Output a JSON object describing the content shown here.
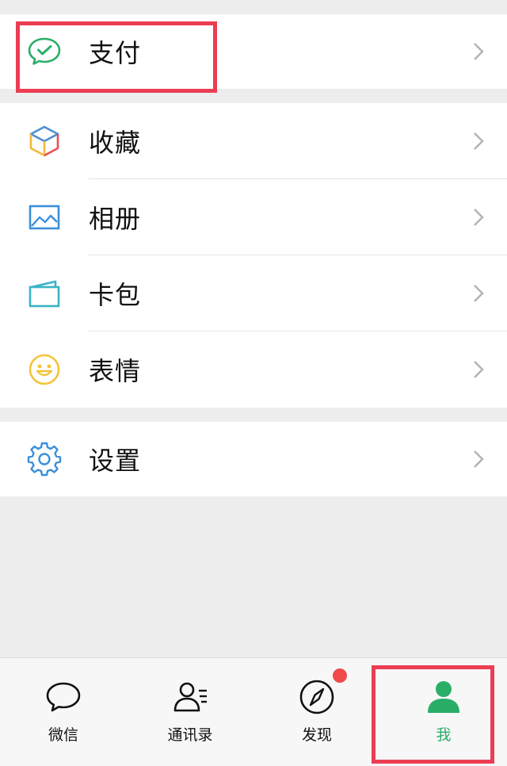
{
  "menu": {
    "pay": {
      "label": "支付",
      "icon": "wechat-pay-icon"
    },
    "items": [
      {
        "label": "收藏",
        "icon": "favorites-cube-icon"
      },
      {
        "label": "相册",
        "icon": "album-picture-icon"
      },
      {
        "label": "卡包",
        "icon": "card-wallet-icon"
      },
      {
        "label": "表情",
        "icon": "smiley-face-icon"
      }
    ],
    "settings": {
      "label": "设置",
      "icon": "gear-icon"
    }
  },
  "tabs": [
    {
      "label": "微信",
      "icon": "chat-bubble-icon",
      "active": false
    },
    {
      "label": "通讯录",
      "icon": "contacts-icon",
      "active": false
    },
    {
      "label": "发现",
      "icon": "compass-icon",
      "active": false,
      "badge": true
    },
    {
      "label": "我",
      "icon": "person-icon",
      "active": true
    }
  ],
  "colors": {
    "accent_green": "#2aae67",
    "highlight_red": "#ec3d52",
    "badge_red": "#f04a4a",
    "page_bg": "#ededed"
  }
}
